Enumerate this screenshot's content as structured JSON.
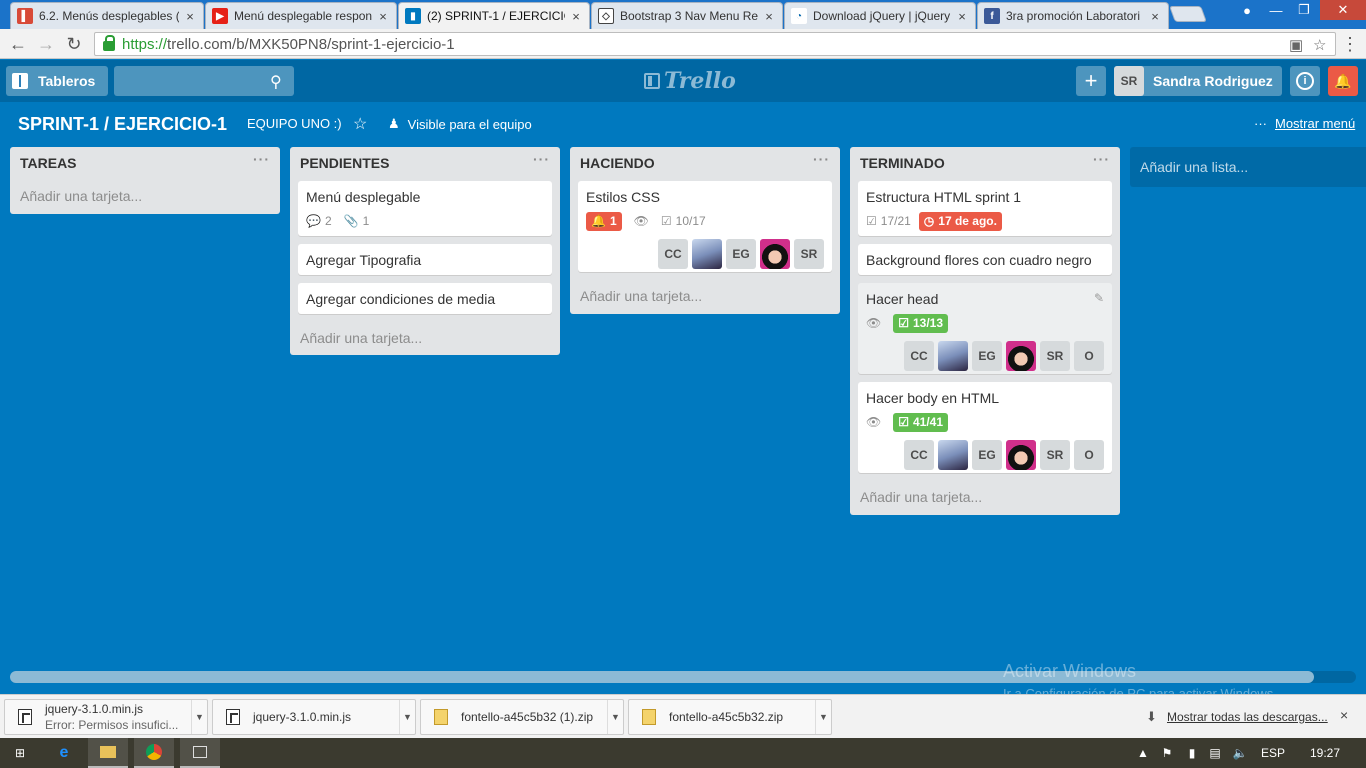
{
  "browser": {
    "tabs": [
      {
        "title": "6.2. Menús desplegables (",
        "favicon": "book-icon",
        "favicon_color": "#d84a38",
        "close": "×"
      },
      {
        "title": "Menú desplegable respon",
        "favicon": "youtube-icon",
        "favicon_color": "#e62117",
        "close": "×"
      },
      {
        "title": "(2) SPRINT-1 / EJERCICIO-",
        "favicon": "trello-icon",
        "favicon_color": "#0079bf",
        "close": "×"
      },
      {
        "title": "Bootstrap 3 Nav Menu Re",
        "favicon": "codepen-icon",
        "favicon_color": "#444444",
        "close": "×"
      },
      {
        "title": "Download jQuery | jQuery",
        "favicon": "jquery-icon",
        "favicon_color": "#0769ad",
        "close": "×"
      },
      {
        "title": "3ra promoción Laboratori",
        "favicon": "facebook-icon",
        "favicon_color": "#3b5998",
        "close": "×"
      }
    ],
    "url_protocol": "https://",
    "url_rest": "trello.com/b/MXK50PN8/sprint-1-ejercicio-1"
  },
  "header": {
    "boards_label": "Tableros",
    "search_placeholder": "",
    "logo": "Trello",
    "add_label": "+",
    "user_initials": "SR",
    "user_name": "Sandra Rodriguez",
    "info_label": "i",
    "notif_color": "#eb5a46"
  },
  "board": {
    "title": "SPRINT-1 / EJERCICIO-1",
    "team": "EQUIPO UNO :)",
    "visibility": "Visible para el equipo",
    "show_menu": "Mostrar menú",
    "add_list": "Añadir una lista..."
  },
  "lists": [
    {
      "name": "TAREAS",
      "add_card": "Añadir una tarjeta..."
    },
    {
      "name": "PENDIENTES",
      "add_card": "Añadir una tarjeta...",
      "cards": [
        {
          "title": "Menú desplegable",
          "comments": "2",
          "attachments": "1"
        },
        {
          "title": "Agregar Tipografia"
        },
        {
          "title": "Agregar condiciones de media"
        }
      ]
    },
    {
      "name": "HACIENDO",
      "add_card": "Añadir una tarjeta...",
      "cards": [
        {
          "title": "Estilos CSS",
          "notifications": "1",
          "checklist": "10/17",
          "members": [
            "CC",
            "",
            "EG",
            "",
            "SR"
          ]
        }
      ]
    },
    {
      "name": "TERMINADO",
      "add_card": "Añadir una tarjeta...",
      "cards": [
        {
          "title": "Estructura HTML sprint 1",
          "checklist": "17/21",
          "due": "17 de ago."
        },
        {
          "title": "Background flores con cuadro negro"
        },
        {
          "title": "Hacer head",
          "checklist": "13/13",
          "members": [
            "CC",
            "",
            "EG",
            "",
            "SR",
            "O"
          ]
        },
        {
          "title": "Hacer body en HTML",
          "checklist": "41/41",
          "members": [
            "CC",
            "",
            "EG",
            "",
            "SR",
            "O"
          ]
        }
      ]
    }
  ],
  "menu_dots": "···",
  "watermark": {
    "line1": "Activar Windows",
    "line2": "Ir a Configuración de PC para activar Windows."
  },
  "downloads": {
    "items": [
      {
        "name": "jquery-3.1.0.min.js",
        "status": "Error: Permisos insufici..."
      },
      {
        "name": "jquery-3.1.0.min.js"
      },
      {
        "name": "fontello-a45c5b32 (1).zip"
      },
      {
        "name": "fontello-a45c5b32.zip"
      }
    ],
    "show_all": "Mostrar todas las descargas...",
    "close": "×"
  },
  "taskbar": {
    "lang": "ESP",
    "time": "19:27"
  }
}
